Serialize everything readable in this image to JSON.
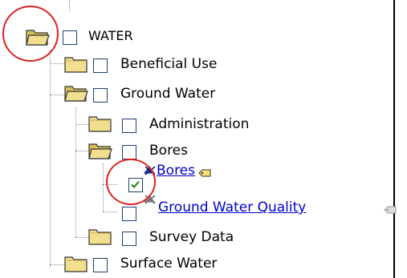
{
  "tree": {
    "root": {
      "label": "WATER",
      "icon": "folder-open-icon",
      "checked": false
    },
    "items": [
      {
        "label": "Beneficial Use",
        "icon": "folder-closed-icon",
        "checked": false
      },
      {
        "label": "Ground Water",
        "icon": "folder-open-icon",
        "checked": false
      },
      {
        "label": "Administration",
        "icon": "folder-closed-icon",
        "checked": false
      },
      {
        "label": "Bores",
        "icon": "folder-open-icon",
        "checked": false
      },
      {
        "label": "Bores",
        "icon": "layer-icon",
        "checked": true,
        "link": true
      },
      {
        "label": "Ground Water Quality",
        "icon": "layer-icon-disabled",
        "checked": false,
        "link": true
      },
      {
        "label": "Survey Data",
        "icon": "folder-closed-icon",
        "checked": false
      },
      {
        "label": "Surface Water",
        "icon": "folder-closed-icon",
        "checked": false
      }
    ]
  },
  "colors": {
    "highlight": "#e02020",
    "link": "#0000cc",
    "checkbox_border": "#1c3f6e",
    "folder": "#e8d27a"
  }
}
